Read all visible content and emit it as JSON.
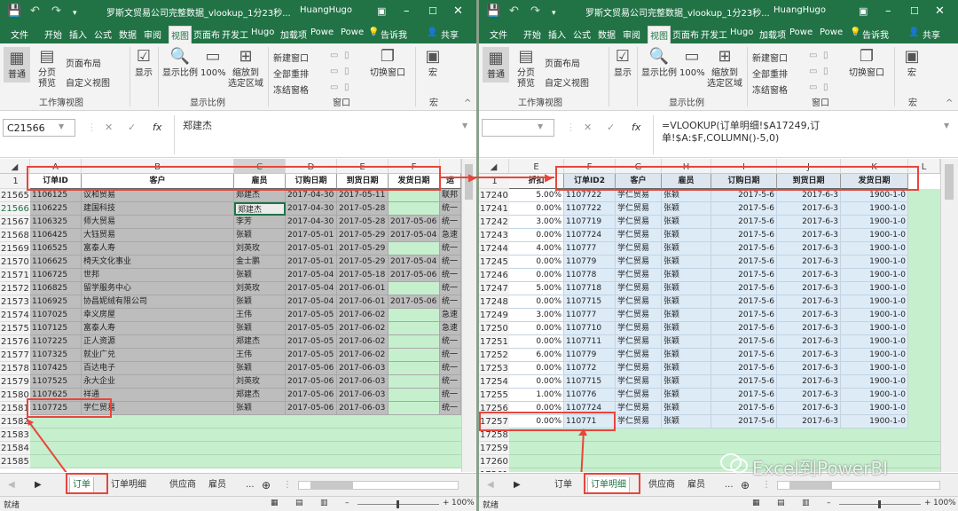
{
  "colors": {
    "excel_green": "#217346",
    "grid_gray": "#bfbfbf",
    "grid_green": "#c6efce",
    "grid_blue": "#ddebf7",
    "annotation_red": "#e8453c"
  },
  "left": {
    "title": "罗斯文贸易公司完整数据_vlookup_1分23秒...",
    "user": "HuangHugo",
    "tabs": [
      "文件",
      "开始",
      "插入",
      "公式",
      "数据",
      "审阅",
      "视图",
      "页面布",
      "开发工",
      "Hugo",
      "加载项",
      "Powe",
      "Powe"
    ],
    "tell_me": "告诉我",
    "share": "共享",
    "ribbon": {
      "normal": "普通",
      "page_break": "分页\n预览",
      "page_layout": "页面布局",
      "custom_view": "自定义视图",
      "group_workbook_views": "工作簿视图",
      "show": "显示",
      "zoom": "显示比例",
      "zoom100": "100%",
      "zoom_selection": "缩放到\n选定区域",
      "group_zoom": "显示比例",
      "new_window": "新建窗口",
      "arrange_all": "全部重排",
      "freeze_panes": "冻结窗格",
      "group_window": "窗口",
      "switch_windows": "切换窗口",
      "macros": "宏",
      "group_macros": "宏"
    },
    "name_box": "C21566",
    "formula": "郑建杰",
    "columns": [
      "A",
      "B",
      "C",
      "D",
      "E",
      "F"
    ],
    "headers": [
      "订单ID",
      "客户",
      "雇员",
      "订购日期",
      "到货日期",
      "发货日期",
      "运"
    ],
    "header_row": "1",
    "rows": [
      {
        "r": "21565",
        "a": "1106125",
        "b": "议和贸易",
        "c": "郑建杰",
        "d": "2017-04-30",
        "e": "2017-05-11",
        "f": "",
        "g": "联邦"
      },
      {
        "r": "21566",
        "a": "1106225",
        "b": "建国科技",
        "c": "郑建杰",
        "d": "2017-04-30",
        "e": "2017-05-28",
        "f": "",
        "g": "统一"
      },
      {
        "r": "21567",
        "a": "1106325",
        "b": "师大贸易",
        "c": "李芳",
        "d": "2017-04-30",
        "e": "2017-05-28",
        "f": "2017-05-06",
        "g": "统一"
      },
      {
        "r": "21568",
        "a": "1106425",
        "b": "大钰贸易",
        "c": "张颖",
        "d": "2017-05-01",
        "e": "2017-05-29",
        "f": "2017-05-04",
        "g": "急速"
      },
      {
        "r": "21569",
        "a": "1106525",
        "b": "富泰人寿",
        "c": "刘英玫",
        "d": "2017-05-01",
        "e": "2017-05-29",
        "f": "",
        "g": "统一"
      },
      {
        "r": "21570",
        "a": "1106625",
        "b": "椅天文化事业",
        "c": "金士鹏",
        "d": "2017-05-01",
        "e": "2017-05-29",
        "f": "2017-05-04",
        "g": "统一"
      },
      {
        "r": "21571",
        "a": "1106725",
        "b": "世邦",
        "c": "张颖",
        "d": "2017-05-04",
        "e": "2017-05-18",
        "f": "2017-05-06",
        "g": "统一"
      },
      {
        "r": "21572",
        "a": "1106825",
        "b": "留学服务中心",
        "c": "刘英玫",
        "d": "2017-05-04",
        "e": "2017-06-01",
        "f": "",
        "g": "统一"
      },
      {
        "r": "21573",
        "a": "1106925",
        "b": "协昌妮绒有限公司",
        "c": "张颖",
        "d": "2017-05-04",
        "e": "2017-06-01",
        "f": "2017-05-06",
        "g": "统一"
      },
      {
        "r": "21574",
        "a": "1107025",
        "b": "幸义房屋",
        "c": "王伟",
        "d": "2017-05-05",
        "e": "2017-06-02",
        "f": "",
        "g": "急速"
      },
      {
        "r": "21575",
        "a": "1107125",
        "b": "富泰人寿",
        "c": "张颖",
        "d": "2017-05-05",
        "e": "2017-06-02",
        "f": "",
        "g": "急速"
      },
      {
        "r": "21576",
        "a": "1107225",
        "b": "正人资源",
        "c": "郑建杰",
        "d": "2017-05-05",
        "e": "2017-06-02",
        "f": "",
        "g": "统一"
      },
      {
        "r": "21577",
        "a": "1107325",
        "b": "就业广兑",
        "c": "王伟",
        "d": "2017-05-05",
        "e": "2017-06-02",
        "f": "",
        "g": "统一"
      },
      {
        "r": "21578",
        "a": "1107425",
        "b": "百达电子",
        "c": "张颖",
        "d": "2017-05-06",
        "e": "2017-06-03",
        "f": "",
        "g": "统一"
      },
      {
        "r": "21579",
        "a": "1107525",
        "b": "永大企业",
        "c": "刘英玫",
        "d": "2017-05-06",
        "e": "2017-06-03",
        "f": "",
        "g": "统一"
      },
      {
        "r": "21580",
        "a": "1107625",
        "b": "祥通",
        "c": "郑建杰",
        "d": "2017-05-06",
        "e": "2017-06-03",
        "f": "",
        "g": "统一"
      },
      {
        "r": "21581",
        "a": "1107725",
        "b": "学仁贸易",
        "c": "张颖",
        "d": "2017-05-06",
        "e": "2017-06-03",
        "f": "",
        "g": "统一"
      }
    ],
    "empty_rows": [
      "21582",
      "21583",
      "21584",
      "21585"
    ],
    "sheet_tabs": [
      "订单",
      "订单明细",
      "供应商",
      "雇员",
      "..."
    ],
    "status": "就绪",
    "zoom_pct": "100%"
  },
  "right": {
    "title": "罗斯文贸易公司完整数据_vlookup_1分23秒...",
    "user": "HuangHugo",
    "tabs": [
      "文件",
      "开始",
      "插入",
      "公式",
      "数据",
      "审阅",
      "视图",
      "页面布",
      "开发工",
      "Hugo",
      "加载项",
      "Powe",
      "Powe"
    ],
    "tell_me": "告诉我",
    "share": "共享",
    "ribbon": {
      "normal": "普通",
      "page_break": "分页\n预览",
      "page_layout": "页面布局",
      "custom_view": "自定义视图",
      "group_workbook_views": "工作簿视图",
      "show": "显示",
      "zoom": "显示比例",
      "zoom100": "100%",
      "zoom_selection": "缩放到\n选定区域",
      "group_zoom": "显示比例",
      "new_window": "新建窗口",
      "arrange_all": "全部重排",
      "freeze_panes": "冻结窗格",
      "group_window": "窗口",
      "switch_windows": "切换窗口",
      "macros": "宏",
      "group_macros": "宏"
    },
    "name_box": "",
    "formula": "=VLOOKUP(订单明细!$A17249,订单!$A:$F,COLUMN()-5,0)",
    "columns": [
      "E",
      "F",
      "G",
      "H",
      "I",
      "J",
      "K",
      "L"
    ],
    "headers": [
      "折扣",
      "订单ID2",
      "客户",
      "雇员",
      "订购日期",
      "到货日期",
      "发货日期"
    ],
    "header_row": "1",
    "rows": [
      {
        "r": "17240",
        "e": "5.00%",
        "f": "1107722",
        "g": "学仁贸易",
        "h": "张颖",
        "i": "2017-5-6",
        "j": "2017-6-3",
        "k": "1900-1-0"
      },
      {
        "r": "17241",
        "e": "0.00%",
        "f": "1107722",
        "g": "学仁贸易",
        "h": "张颖",
        "i": "2017-5-6",
        "j": "2017-6-3",
        "k": "1900-1-0"
      },
      {
        "r": "17242",
        "e": "3.00%",
        "f": "1107719",
        "g": "学仁贸易",
        "h": "张颖",
        "i": "2017-5-6",
        "j": "2017-6-3",
        "k": "1900-1-0"
      },
      {
        "r": "17243",
        "e": "0.00%",
        "f": "1107724",
        "g": "学仁贸易",
        "h": "张颖",
        "i": "2017-5-6",
        "j": "2017-6-3",
        "k": "1900-1-0"
      },
      {
        "r": "17244",
        "e": "4.00%",
        "f": "110777",
        "g": "学仁贸易",
        "h": "张颖",
        "i": "2017-5-6",
        "j": "2017-6-3",
        "k": "1900-1-0"
      },
      {
        "r": "17245",
        "e": "0.00%",
        "f": "110779",
        "g": "学仁贸易",
        "h": "张颖",
        "i": "2017-5-6",
        "j": "2017-6-3",
        "k": "1900-1-0"
      },
      {
        "r": "17246",
        "e": "0.00%",
        "f": "110778",
        "g": "学仁贸易",
        "h": "张颖",
        "i": "2017-5-6",
        "j": "2017-6-3",
        "k": "1900-1-0"
      },
      {
        "r": "17247",
        "e": "5.00%",
        "f": "1107718",
        "g": "学仁贸易",
        "h": "张颖",
        "i": "2017-5-6",
        "j": "2017-6-3",
        "k": "1900-1-0"
      },
      {
        "r": "17248",
        "e": "0.00%",
        "f": "1107715",
        "g": "学仁贸易",
        "h": "张颖",
        "i": "2017-5-6",
        "j": "2017-6-3",
        "k": "1900-1-0"
      },
      {
        "r": "17249",
        "e": "3.00%",
        "f": "110777",
        "g": "学仁贸易",
        "h": "张颖",
        "i": "2017-5-6",
        "j": "2017-6-3",
        "k": "1900-1-0"
      },
      {
        "r": "17250",
        "e": "0.00%",
        "f": "1107710",
        "g": "学仁贸易",
        "h": "张颖",
        "i": "2017-5-6",
        "j": "2017-6-3",
        "k": "1900-1-0"
      },
      {
        "r": "17251",
        "e": "0.00%",
        "f": "1107711",
        "g": "学仁贸易",
        "h": "张颖",
        "i": "2017-5-6",
        "j": "2017-6-3",
        "k": "1900-1-0"
      },
      {
        "r": "17252",
        "e": "6.00%",
        "f": "110779",
        "g": "学仁贸易",
        "h": "张颖",
        "i": "2017-5-6",
        "j": "2017-6-3",
        "k": "1900-1-0"
      },
      {
        "r": "17253",
        "e": "0.00%",
        "f": "110772",
        "g": "学仁贸易",
        "h": "张颖",
        "i": "2017-5-6",
        "j": "2017-6-3",
        "k": "1900-1-0"
      },
      {
        "r": "17254",
        "e": "0.00%",
        "f": "1107715",
        "g": "学仁贸易",
        "h": "张颖",
        "i": "2017-5-6",
        "j": "2017-6-3",
        "k": "1900-1-0"
      },
      {
        "r": "17255",
        "e": "1.00%",
        "f": "110776",
        "g": "学仁贸易",
        "h": "张颖",
        "i": "2017-5-6",
        "j": "2017-6-3",
        "k": "1900-1-0"
      },
      {
        "r": "17256",
        "e": "0.00%",
        "f": "1107724",
        "g": "学仁贸易",
        "h": "张颖",
        "i": "2017-5-6",
        "j": "2017-6-3",
        "k": "1900-1-0"
      },
      {
        "r": "17257",
        "e": "0.00%",
        "f": "110771",
        "g": "学仁贸易",
        "h": "张颖",
        "i": "2017-5-6",
        "j": "2017-6-3",
        "k": "1900-1-0"
      }
    ],
    "empty_rows": [
      "17258",
      "17259",
      "17260",
      "17261"
    ],
    "sheet_tabs": [
      "订单",
      "订单明细",
      "供应商",
      "雇员",
      "..."
    ],
    "status": "就绪",
    "zoom_pct": "100%"
  },
  "watermark": "Excel到PowerBI"
}
